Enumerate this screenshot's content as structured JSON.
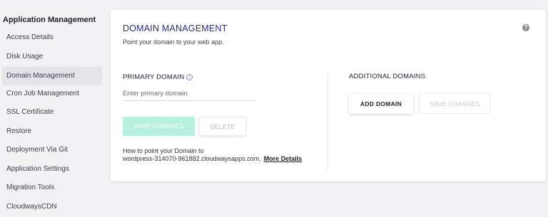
{
  "sidebar": {
    "title": "Application Management",
    "items": [
      {
        "label": "Access Details",
        "active": false
      },
      {
        "label": "Disk Usage",
        "active": false
      },
      {
        "label": "Domain Management",
        "active": true
      },
      {
        "label": "Cron Job Management",
        "active": false
      },
      {
        "label": "SSL Certificate",
        "active": false
      },
      {
        "label": "Restore",
        "active": false
      },
      {
        "label": "Deployment Via Git",
        "active": false
      },
      {
        "label": "Application Settings",
        "active": false
      },
      {
        "label": "Migration Tools",
        "active": false
      },
      {
        "label": "CloudwaysCDN",
        "active": false
      }
    ]
  },
  "card": {
    "title": "DOMAIN MANAGEMENT",
    "subtitle": "Point your domain to your web app.",
    "help_icon": "question-circle-icon"
  },
  "primary": {
    "label": "PRIMARY DOMAIN",
    "info_icon": "info-circle-icon",
    "input_placeholder": "Enter primary domain",
    "input_value": "",
    "save_label": "SAVE CHANGES",
    "delete_label": "DELETE",
    "help_line1": "How to point your Domain to",
    "help_line2": "wordpress-314070-961882.cloudwaysapps.com.",
    "more_details_label": "More Details"
  },
  "additional": {
    "label": "ADDITIONAL DOMAINS",
    "add_label": "ADD DOMAIN",
    "save_label": "SAVE CHANGES"
  },
  "colors": {
    "accent": "#2d2c8a",
    "save_primary_bg": "#b8f0e0",
    "active_nav_bg": "#e4e4e8",
    "page_bg": "#f2f2f4"
  }
}
